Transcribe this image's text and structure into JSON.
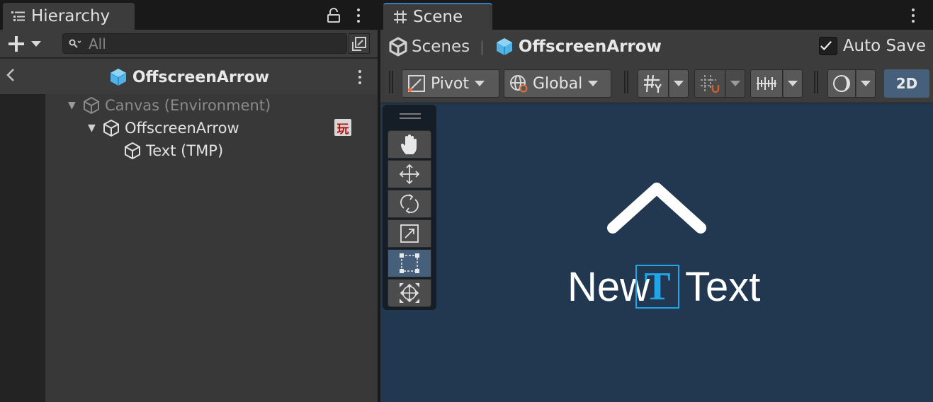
{
  "hierarchy": {
    "tab_label": "Hierarchy",
    "search_placeholder": "All",
    "header_title": "OffscreenArrow",
    "tree": [
      {
        "label": "Canvas (Environment)",
        "depth": 0,
        "expanded": true,
        "dimmed": true
      },
      {
        "label": "OffscreenArrow",
        "depth": 1,
        "expanded": true,
        "dimmed": false,
        "badge": "玩"
      },
      {
        "label": "Text (TMP)",
        "depth": 2,
        "expanded": false,
        "dimmed": false
      }
    ]
  },
  "scene": {
    "tab_label": "Scene",
    "breadcrumb": {
      "root": "Scenes",
      "current": "OffscreenArrow"
    },
    "autosave": {
      "label": "Auto Save",
      "checked": true
    },
    "toolbar": {
      "pivot_label": "Pivot",
      "global_label": "Global",
      "mode_2d_label": "2D"
    },
    "tools": [
      "hand-tool",
      "move-tool",
      "rotate-tool",
      "scale-tool",
      "rect-tool",
      "transform-tool"
    ],
    "active_tool": "rect-tool",
    "viewport": {
      "text_object": "New Text",
      "text_before": "New",
      "text_after": "Text",
      "tmp_glyph": "T"
    }
  },
  "colors": {
    "panel_bg": "#282828",
    "toolbar_bg": "#3c3c3c",
    "viewport_bg": "#213850",
    "accent_blue": "#46607c",
    "cube_blue": "#4fb3e8",
    "tmp_blue": "#1fa5e8"
  }
}
